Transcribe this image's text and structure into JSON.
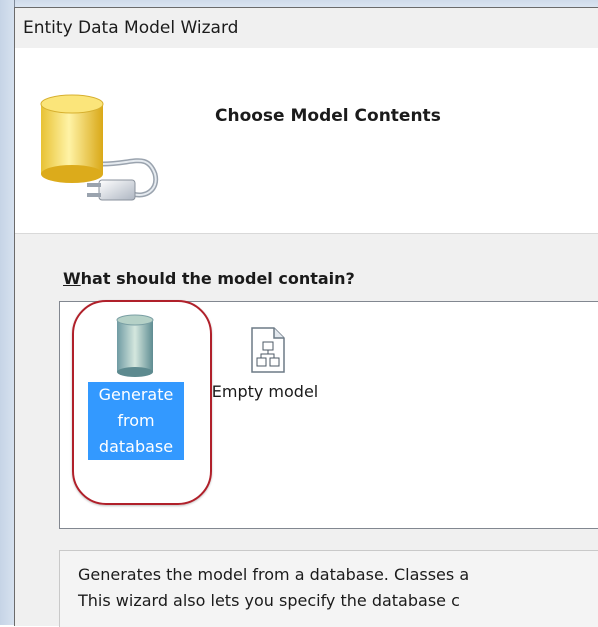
{
  "window": {
    "title": "Entity Data Model Wizard"
  },
  "header": {
    "title": "Choose Model Contents",
    "icon": "database-plug-icon"
  },
  "question": {
    "accesskey": "W",
    "rest": "hat should the model contain?"
  },
  "options": [
    {
      "label": "Generate\nfrom\ndatabase",
      "icon": "database-icon",
      "selected": true
    },
    {
      "label": "Empty model",
      "icon": "empty-model-document-icon",
      "selected": false
    }
  ],
  "description": {
    "line1": "Generates the model from a database. Classes a",
    "line2": "This wizard also lets you specify the database c"
  },
  "colors": {
    "selection": "#3399ff",
    "highlight_ring": "#b0202a"
  }
}
